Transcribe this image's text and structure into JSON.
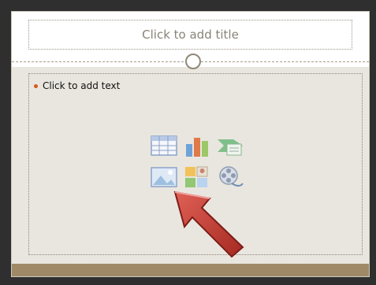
{
  "slide": {
    "title_placeholder": "Click to add title",
    "body_placeholder": "Click to add text"
  },
  "content_icons": [
    {
      "name": "insert-table-icon"
    },
    {
      "name": "insert-chart-icon"
    },
    {
      "name": "insert-smartart-icon"
    },
    {
      "name": "insert-picture-icon"
    },
    {
      "name": "insert-clipart-icon"
    },
    {
      "name": "insert-media-icon"
    }
  ],
  "annotation": {
    "icon": "red-pointer-arrow-icon",
    "color": "#c0392b"
  },
  "colors": {
    "slide_background": "#e9e6df",
    "footer_band": "#a08966",
    "bullet": "#d65b1a"
  }
}
